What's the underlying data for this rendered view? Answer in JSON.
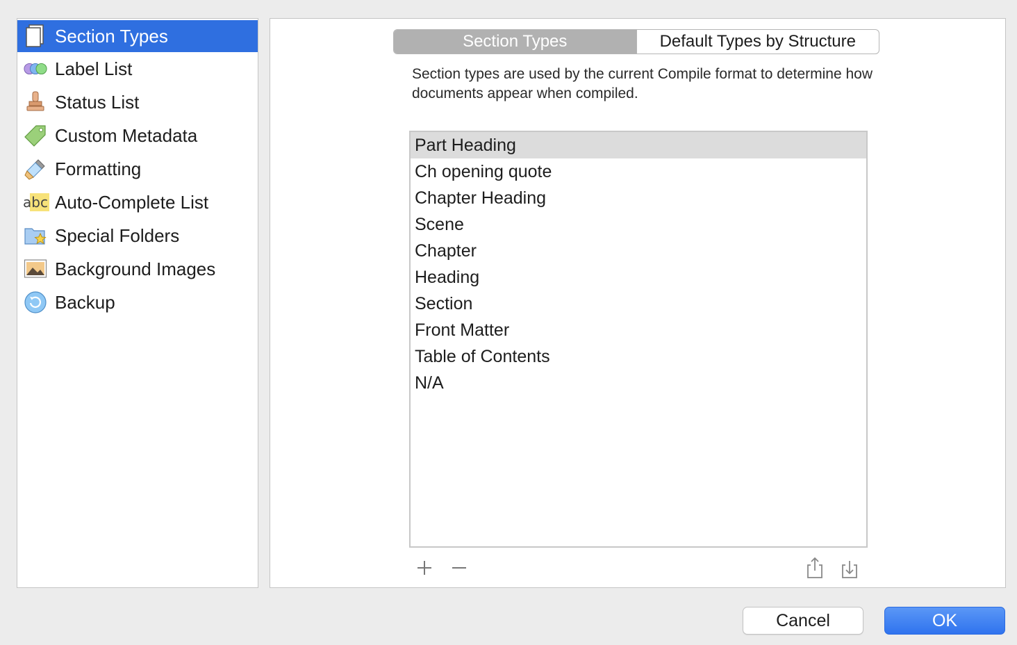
{
  "sidebar": {
    "items": [
      {
        "label": "Section Types",
        "icon": "document-icon",
        "active": true
      },
      {
        "label": "Label List",
        "icon": "color-circles-icon",
        "active": false
      },
      {
        "label": "Status List",
        "icon": "stamp-icon",
        "active": false
      },
      {
        "label": "Custom Metadata",
        "icon": "tag-icon",
        "active": false
      },
      {
        "label": "Formatting",
        "icon": "paintbrush-icon",
        "active": false
      },
      {
        "label": "Auto-Complete List",
        "icon": "abc-icon",
        "active": false
      },
      {
        "label": "Special Folders",
        "icon": "star-folder-icon",
        "active": false
      },
      {
        "label": "Background Images",
        "icon": "picture-icon",
        "active": false
      },
      {
        "label": "Backup",
        "icon": "backup-icon",
        "active": false
      }
    ],
    "abc_text": "abc"
  },
  "main": {
    "tabs": [
      {
        "label": "Section Types",
        "selected": true
      },
      {
        "label": "Default Types by Structure",
        "selected": false
      }
    ],
    "description": "Section types are used by the current Compile format to determine how documents appear when compiled.",
    "section_types": [
      "Part Heading",
      "Ch opening quote",
      "Chapter Heading",
      "Scene",
      "Chapter",
      "Heading",
      "Section",
      "Front Matter",
      "Table of Contents",
      "N/A"
    ],
    "selected_index": 0
  },
  "footer": {
    "cancel_label": "Cancel",
    "ok_label": "OK"
  },
  "colors": {
    "accent": "#2f6fe0",
    "ok_button": "#2f73ee",
    "selected_tab": "#b1b1b1",
    "selected_row": "#dcdcdc"
  }
}
